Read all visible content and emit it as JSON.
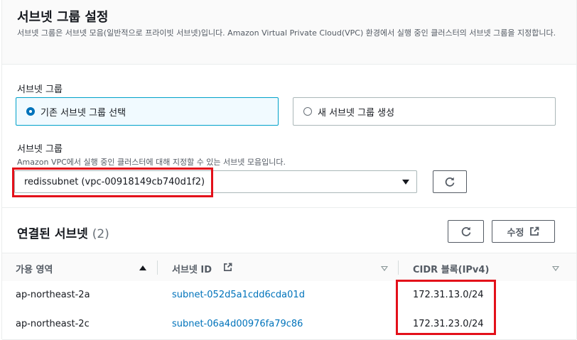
{
  "section": {
    "title": "서브넷 그룹 설정",
    "description": "서브넷 그룹은 서브넷 모음(일반적으로 프라이빗 서브넷)입니다. Amazon Virtual Private Cloud(VPC) 환경에서 실행 중인 클러스터의 서브넷 그룹을 지정합니다."
  },
  "subnet_group_choice": {
    "label": "서브넷 그룹",
    "options": [
      {
        "label": "기존 서브넷 그룹 선택",
        "selected": true
      },
      {
        "label": "새 서브넷 그룹 생성",
        "selected": false
      }
    ]
  },
  "subnet_group_select": {
    "label": "서브넷 그룹",
    "description": "Amazon VPC에서 실행 중인 클러스터에 대해 지정할 수 있는 서브넷 모음입니다.",
    "value": "redissubnet (vpc-00918149cb740d1f2)",
    "caret_icon": "caret-down-icon",
    "refresh_icon": "refresh-icon"
  },
  "associated_subnets": {
    "title": "연결된 서브넷",
    "count": "(2)",
    "refresh_icon": "refresh-icon",
    "edit_label": "수정",
    "edit_icon": "external-link-icon",
    "columns": [
      {
        "label": "가용 영역",
        "sort": "ascending"
      },
      {
        "label": "서브넷 ID",
        "icon": "external-link-icon"
      },
      {
        "label": "CIDR 블록(IPv4)"
      }
    ],
    "rows": [
      {
        "az": "ap-northeast-2a",
        "subnet_id": "subnet-052d5a1cdd6cda01d",
        "cidr": "172.31.13.0/24"
      },
      {
        "az": "ap-northeast-2c",
        "subnet_id": "subnet-06a4d00976fa79c86",
        "cidr": "172.31.23.0/24"
      }
    ]
  },
  "colors": {
    "accent": "#0073bb",
    "selected_bg": "#f1faff",
    "highlight": "#e3101a"
  }
}
